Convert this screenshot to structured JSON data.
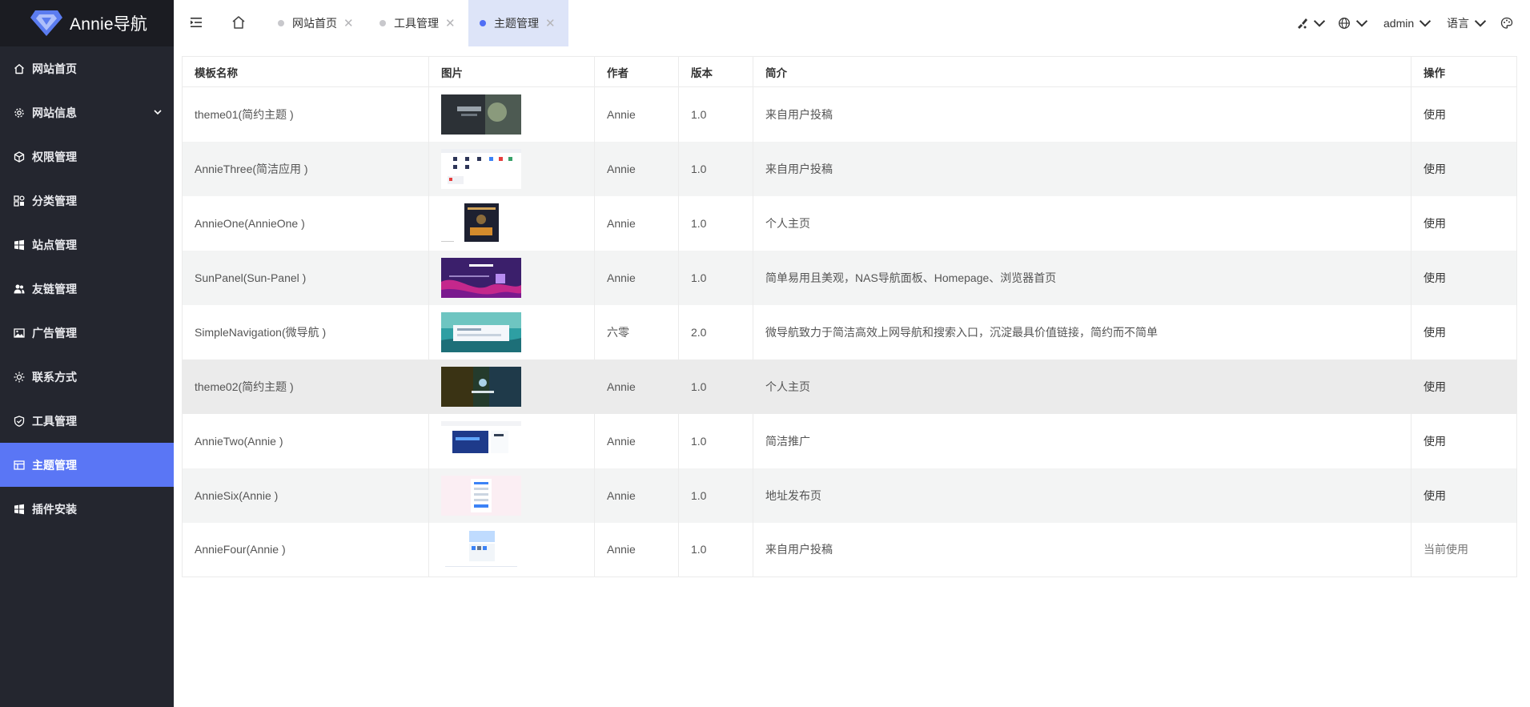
{
  "app": {
    "title": "Annie导航"
  },
  "sidebar": {
    "items": [
      {
        "label": "网站首页",
        "icon": "home-icon"
      },
      {
        "label": "网站信息",
        "icon": "gear-icon",
        "expandable": true
      },
      {
        "label": "权限管理",
        "icon": "cube-icon"
      },
      {
        "label": "分类管理",
        "icon": "category-icon"
      },
      {
        "label": "站点管理",
        "icon": "windows-icon"
      },
      {
        "label": "友链管理",
        "icon": "users-icon"
      },
      {
        "label": "广告管理",
        "icon": "image-icon"
      },
      {
        "label": "联系方式",
        "icon": "sun-icon"
      },
      {
        "label": "工具管理",
        "icon": "shield-check-icon"
      },
      {
        "label": "主题管理",
        "icon": "layout-icon",
        "active": true
      },
      {
        "label": "插件安装",
        "icon": "windows-icon"
      }
    ]
  },
  "header": {
    "tabs": [
      {
        "label": "网站首页",
        "active": false
      },
      {
        "label": "工具管理",
        "active": false
      },
      {
        "label": "主题管理",
        "active": true
      }
    ],
    "close_glyph": "✕",
    "user": "admin",
    "language_label": "语言"
  },
  "table": {
    "columns": [
      "模板名称",
      "图片",
      "作者",
      "版本",
      "简介",
      "操作"
    ],
    "rows": [
      {
        "name": "theme01(简约主题 )",
        "thumb": "dark-photo",
        "author": "Annie",
        "version": "1.0",
        "desc": "来自用户投稿",
        "action": "使用"
      },
      {
        "name": "AnnieThree(简洁应用 )",
        "thumb": "white-grid",
        "author": "Annie",
        "version": "1.0",
        "desc": "来自用户投稿",
        "action": "使用"
      },
      {
        "name": "AnnieOne(AnnieOne )",
        "thumb": "dark-portrait",
        "author": "Annie",
        "version": "1.0",
        "desc": "个人主页",
        "action": "使用"
      },
      {
        "name": "SunPanel(Sun-Panel )",
        "thumb": "purple-waves",
        "author": "Annie",
        "version": "1.0",
        "desc": "简单易用且美观，NAS导航面板、Homepage、浏览器首页",
        "action": "使用"
      },
      {
        "name": "SimpleNavigation(微导航 )",
        "thumb": "teal-sea",
        "author": "六零",
        "version": "2.0",
        "desc": "微导航致力于简洁高效上网导航和搜索入口，沉淀最具价值链接，简约而不简单",
        "action": "使用"
      },
      {
        "name": "theme02(简约主题 )",
        "thumb": "forest-dark",
        "author": "Annie",
        "version": "1.0",
        "desc": "个人主页",
        "action": "使用",
        "highlight": true
      },
      {
        "name": "AnnieTwo(Annie )",
        "thumb": "blue-card",
        "author": "Annie",
        "version": "1.0",
        "desc": "简洁推广",
        "action": "使用"
      },
      {
        "name": "AnnieSix(Annie )",
        "thumb": "pink-form",
        "author": "Annie",
        "version": "1.0",
        "desc": "地址发布页",
        "action": "使用"
      },
      {
        "name": "AnnieFour(Annie )",
        "thumb": "light-blue-page",
        "author": "Annie",
        "version": "1.0",
        "desc": "来自用户投稿",
        "action": "当前使用",
        "current": true
      }
    ]
  },
  "colors": {
    "sidebar_bg": "#24262f",
    "logo_bg": "#1b1c22",
    "accent": "#5a76f5",
    "active_tab_bg": "#dde4f8"
  }
}
